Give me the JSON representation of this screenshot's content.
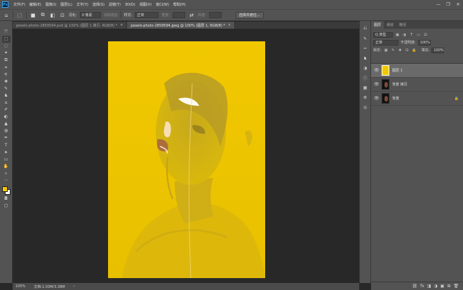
{
  "app": {
    "logo": "Ps"
  },
  "menu": [
    "文件(F)",
    "编辑(E)",
    "图像(I)",
    "图层(L)",
    "文字(Y)",
    "选择(S)",
    "滤镜(T)",
    "3D(D)",
    "视图(V)",
    "窗口(W)",
    "帮助(H)"
  ],
  "window_controls": {
    "minimize": "—",
    "maximize": "❐",
    "close": "✕"
  },
  "options": {
    "feather_label": "羽化:",
    "feather_value": "0 像素",
    "antialias_label": "消除锯齿",
    "style_label": "样式:",
    "style_value": "正常",
    "width_label": "宽度:",
    "height_label": "高度:",
    "select_mask_button": "选择并遮住..."
  },
  "tabs": [
    {
      "label": "pexels-photo-2859594.psd @ 100% (图层 1 拷贝, RGB/8) *",
      "close": "×"
    },
    {
      "label": "pexels-photo-2859594.jpeg @ 100% (图层 1, RGB/8) *",
      "close": "×"
    }
  ],
  "tools": [
    "⤧",
    "⬚",
    "◌",
    "✦",
    "⧉",
    "⌗",
    "⚟",
    "✚",
    "✎",
    "♞",
    "⌂",
    "✐",
    "◐",
    "▲",
    "◍",
    "✒",
    "T",
    "➤",
    "▭",
    "✋",
    "⌕",
    "⋯"
  ],
  "colors": {
    "foreground": "#f1c800",
    "background": "#ffffff",
    "image_bg": "#f1c800"
  },
  "panel": {
    "tabs": [
      "图层",
      "通道",
      "路径"
    ],
    "kind_label": "Q 类型",
    "blend_mode": "正常",
    "opacity_label": "不透明度:",
    "opacity_value": "100%",
    "lock_label": "锁定:",
    "fill_label": "填充:",
    "fill_value": "100%",
    "layers": [
      {
        "name": "图层 1",
        "selected": true,
        "locked": false
      },
      {
        "name": "背景 拷贝",
        "selected": false,
        "locked": false
      },
      {
        "name": "背景",
        "selected": false,
        "locked": true
      }
    ],
    "bottom_icons": [
      "⛓",
      "fx",
      "◨",
      "◑",
      "▣",
      "⊞",
      "🗑"
    ]
  },
  "status": {
    "zoom": "100%",
    "doc": "文档:1.03M/3.38M"
  }
}
